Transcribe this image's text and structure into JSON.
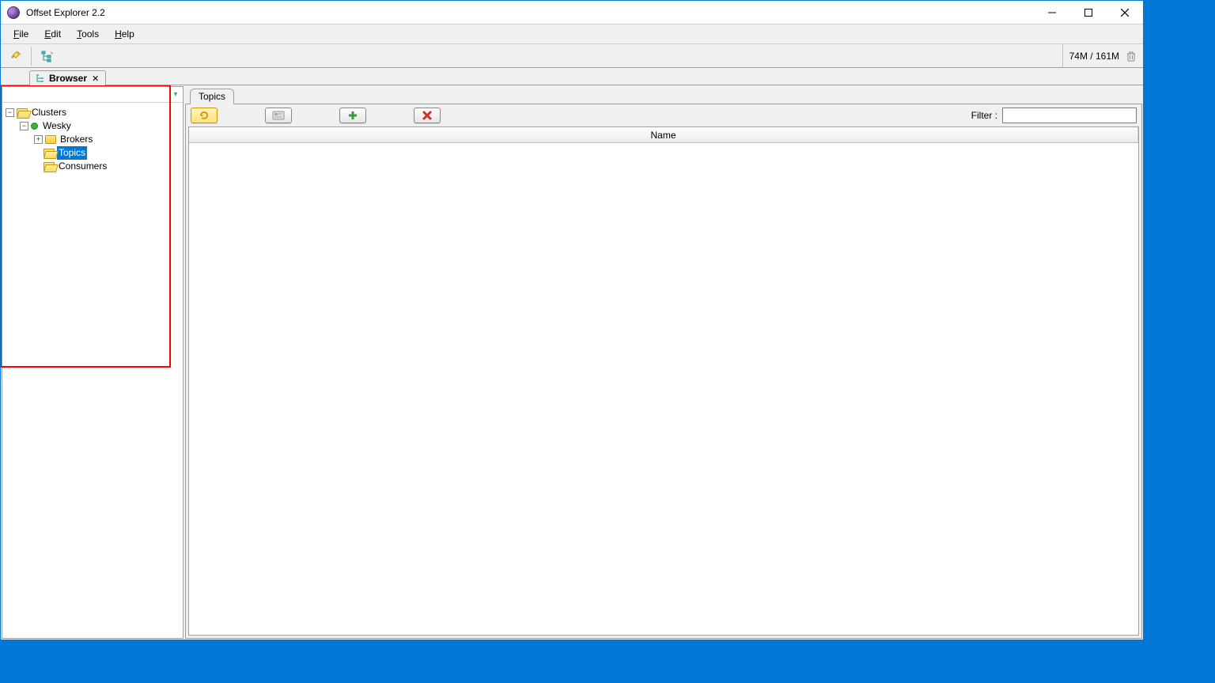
{
  "window": {
    "title": "Offset Explorer  2.2"
  },
  "menu": {
    "file": "File",
    "edit": "Edit",
    "tools": "Tools",
    "help": "Help"
  },
  "memory": {
    "text": "74M / 161M"
  },
  "browser_tab": {
    "label": "Browser"
  },
  "tree": {
    "root": "Clusters",
    "cluster": "Wesky",
    "brokers": "Brokers",
    "topics": "Topics",
    "consumers": "Consumers"
  },
  "main": {
    "tab_label": "Topics",
    "filter_label": "Filter :",
    "filter_value": "",
    "column_name": "Name"
  }
}
